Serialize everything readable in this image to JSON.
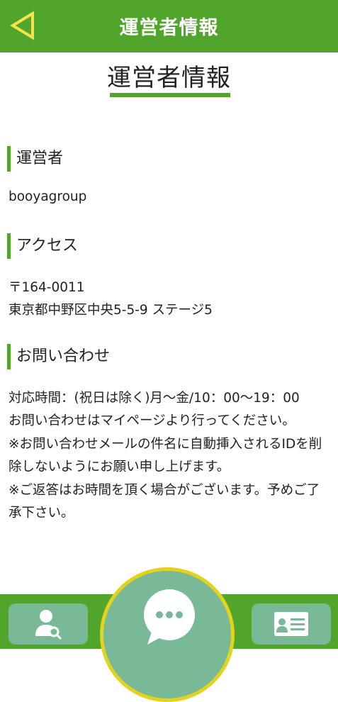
{
  "header": {
    "title": "運営者情報",
    "back_icon": "triangle-left-icon",
    "back_icon_color": "#f4e34a"
  },
  "page": {
    "title": "運営者情報"
  },
  "sections": [
    {
      "heading": "運営者",
      "lines": [
        "booyagroup"
      ]
    },
    {
      "heading": "アクセス",
      "lines": [
        "〒164-0011",
        "東京都中野区中央5-5-9 ステージ5"
      ]
    },
    {
      "heading": "お問い合わせ",
      "lines": [
        "対応時間：(祝日は除く)月〜金/10：00〜19：00",
        "お問い合わせはマイページより行ってください。",
        "※お問い合わせメールの件名に自動挿入されるIDを削",
        "除しないようにお願い申し上げます。",
        "※ご返答はお時間を頂く場合がございます。予めご了",
        "承下さい。"
      ]
    }
  ],
  "footer": {
    "left_icon": "user-search-icon",
    "center_icon": "chat-bubble-icon",
    "right_icon": "id-card-icon"
  },
  "colors": {
    "brand_green": "#52a52b",
    "button_green": "#79b998",
    "accent_yellow": "#e2d41e"
  }
}
